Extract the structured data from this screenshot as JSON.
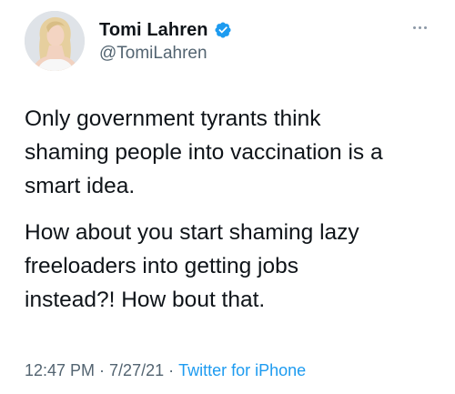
{
  "author": {
    "display_name": "Tomi Lahren",
    "handle": "@TomiLahren",
    "verified": true
  },
  "tweet": {
    "paragraphs": [
      "Only government tyrants think\nshaming people into vaccination is a\nsmart idea.",
      "How about you start shaming lazy\nfreeloaders into getting jobs\ninstead?! How bout that."
    ],
    "time": "12:47 PM",
    "date": "7/27/21",
    "source": "Twitter for iPhone",
    "separator": "·"
  },
  "icons": {
    "verified": "verified-badge-icon",
    "more": "more-options-icon"
  },
  "colors": {
    "text": "#0f1419",
    "secondary": "#536471",
    "link": "#1d9bf0"
  }
}
